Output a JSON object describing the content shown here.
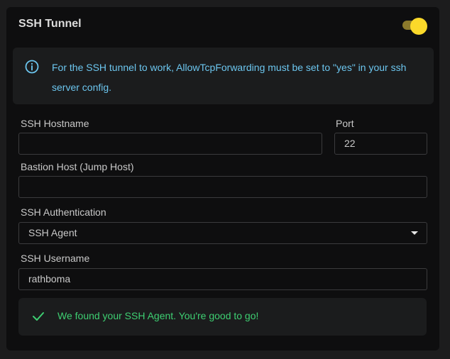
{
  "panel": {
    "title": "SSH Tunnel",
    "toggle_on": true,
    "toggle_color": "#fbd92a"
  },
  "info": {
    "icon": "info-icon",
    "text": "For the SSH tunnel to work, AllowTcpForwarding must be set to \"yes\" in your ssh server config."
  },
  "form": {
    "hostname_label": "SSH Hostname",
    "hostname_value": "",
    "port_label": "Port",
    "port_value": "22",
    "bastion_label": "Bastion Host (Jump Host)",
    "bastion_value": "",
    "auth_label": "SSH Authentication",
    "auth_value": "SSH Agent",
    "username_label": "SSH Username",
    "username_value": "rathboma"
  },
  "success": {
    "icon": "check-icon",
    "text": "We found your SSH Agent. You're good to go!",
    "color": "#3ecf72"
  }
}
